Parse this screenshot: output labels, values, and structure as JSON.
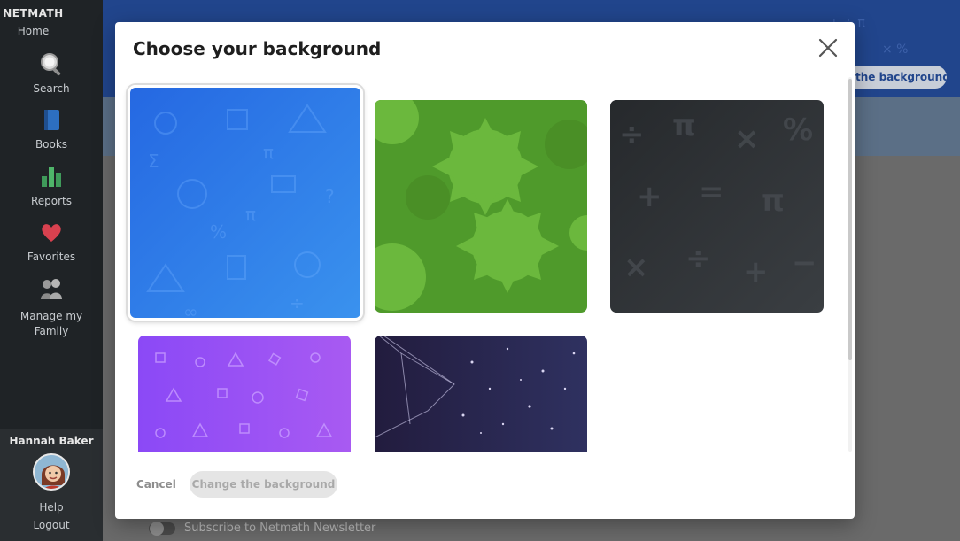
{
  "sidebar": {
    "logo": "NETMATH",
    "home_label": "Home",
    "items": [
      {
        "label": "Search",
        "icon": "search-icon"
      },
      {
        "label": "Books",
        "icon": "book-icon"
      },
      {
        "label": "Reports",
        "icon": "bar-chart-icon"
      },
      {
        "label": "Favorites",
        "icon": "heart-icon"
      },
      {
        "label": "Manage my Family",
        "icon": "family-icon"
      }
    ],
    "user_name": "Hannah Baker",
    "help_label": "Help",
    "logout_label": "Logout"
  },
  "background_page": {
    "header_button_label": "the background",
    "newsletter_label": "Subscribe to Netmath Newsletter"
  },
  "modal": {
    "title": "Choose your background",
    "cancel_label": "Cancel",
    "change_label": "Change the background",
    "backgrounds": [
      {
        "name": "blue-math",
        "color": "#2f7fe6",
        "selected": true
      },
      {
        "name": "green-flowers",
        "color": "#5aa232",
        "selected": false
      },
      {
        "name": "dark-math",
        "color": "#2f3236",
        "selected": false
      },
      {
        "name": "purple-shapes",
        "color": "#9a4ff5",
        "selected": false
      },
      {
        "name": "space-stars",
        "color": "#2e2b52",
        "selected": false
      }
    ]
  }
}
